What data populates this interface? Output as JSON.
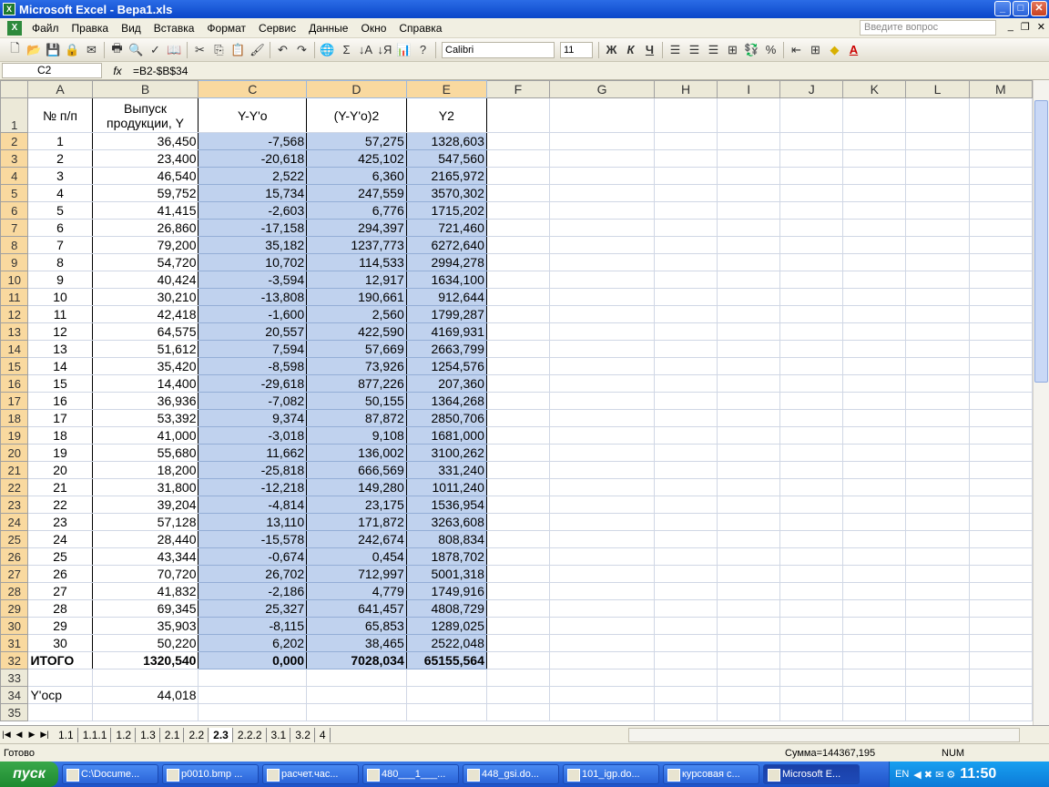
{
  "window": {
    "title": "Microsoft Excel - Вера1.xls"
  },
  "menu": [
    "Файл",
    "Правка",
    "Вид",
    "Вставка",
    "Формат",
    "Сервис",
    "Данные",
    "Окно",
    "Справка"
  ],
  "help_placeholder": "Введите вопрос",
  "toolbar": {
    "font": "Calibri",
    "size": "11",
    "bold": "Ж",
    "italic": "К",
    "underline": "Ч",
    "percent": "%"
  },
  "formula_bar": {
    "cell": "C2",
    "fx": "fx",
    "formula": "=B2-$B$34"
  },
  "columns": [
    "A",
    "B",
    "C",
    "D",
    "E",
    "F",
    "G",
    "H",
    "I",
    "J",
    "K",
    "L",
    "M"
  ],
  "header_row": {
    "a": "№ п/п",
    "b": "Выпуск продукции, Y",
    "c": "Y-Y'o",
    "d": "(Y-Y'o)2",
    "e": "Y2"
  },
  "rows": [
    [
      "1",
      "36,450",
      "-7,568",
      "57,275",
      "1328,603"
    ],
    [
      "2",
      "23,400",
      "-20,618",
      "425,102",
      "547,560"
    ],
    [
      "3",
      "46,540",
      "2,522",
      "6,360",
      "2165,972"
    ],
    [
      "4",
      "59,752",
      "15,734",
      "247,559",
      "3570,302"
    ],
    [
      "5",
      "41,415",
      "-2,603",
      "6,776",
      "1715,202"
    ],
    [
      "6",
      "26,860",
      "-17,158",
      "294,397",
      "721,460"
    ],
    [
      "7",
      "79,200",
      "35,182",
      "1237,773",
      "6272,640"
    ],
    [
      "8",
      "54,720",
      "10,702",
      "114,533",
      "2994,278"
    ],
    [
      "9",
      "40,424",
      "-3,594",
      "12,917",
      "1634,100"
    ],
    [
      "10",
      "30,210",
      "-13,808",
      "190,661",
      "912,644"
    ],
    [
      "11",
      "42,418",
      "-1,600",
      "2,560",
      "1799,287"
    ],
    [
      "12",
      "64,575",
      "20,557",
      "422,590",
      "4169,931"
    ],
    [
      "13",
      "51,612",
      "7,594",
      "57,669",
      "2663,799"
    ],
    [
      "14",
      "35,420",
      "-8,598",
      "73,926",
      "1254,576"
    ],
    [
      "15",
      "14,400",
      "-29,618",
      "877,226",
      "207,360"
    ],
    [
      "16",
      "36,936",
      "-7,082",
      "50,155",
      "1364,268"
    ],
    [
      "17",
      "53,392",
      "9,374",
      "87,872",
      "2850,706"
    ],
    [
      "18",
      "41,000",
      "-3,018",
      "9,108",
      "1681,000"
    ],
    [
      "19",
      "55,680",
      "11,662",
      "136,002",
      "3100,262"
    ],
    [
      "20",
      "18,200",
      "-25,818",
      "666,569",
      "331,240"
    ],
    [
      "21",
      "31,800",
      "-12,218",
      "149,280",
      "1011,240"
    ],
    [
      "22",
      "39,204",
      "-4,814",
      "23,175",
      "1536,954"
    ],
    [
      "23",
      "57,128",
      "13,110",
      "171,872",
      "3263,608"
    ],
    [
      "24",
      "28,440",
      "-15,578",
      "242,674",
      "808,834"
    ],
    [
      "25",
      "43,344",
      "-0,674",
      "0,454",
      "1878,702"
    ],
    [
      "26",
      "70,720",
      "26,702",
      "712,997",
      "5001,318"
    ],
    [
      "27",
      "41,832",
      "-2,186",
      "4,779",
      "1749,916"
    ],
    [
      "28",
      "69,345",
      "25,327",
      "641,457",
      "4808,729"
    ],
    [
      "29",
      "35,903",
      "-8,115",
      "65,853",
      "1289,025"
    ],
    [
      "30",
      "50,220",
      "6,202",
      "38,465",
      "2522,048"
    ]
  ],
  "total_row": {
    "a": "ИТОГО",
    "b": "1320,540",
    "c": "0,000",
    "d": "7028,034",
    "e": "65155,564"
  },
  "avg_row": {
    "a": "Y'оср",
    "b": "44,018"
  },
  "sheets": [
    "1.1",
    "1.1.1",
    "1.2",
    "1.3",
    "2.1",
    "2.2",
    "2.3",
    "2.2.2",
    "3.1",
    "3.2",
    "4"
  ],
  "active_sheet": "2.3",
  "status": {
    "ready": "Готово",
    "sum": "Сумма=144367,195",
    "num": "NUM"
  },
  "taskbar": {
    "start": "пуск",
    "tasks": [
      "C:\\Docume...",
      "p0010.bmp ...",
      "расчет.час...",
      "480___1___...",
      "448_gsi.do...",
      "101_igp.do...",
      "курсовая с...",
      "Microsoft E..."
    ],
    "lang": "EN",
    "clock": "11:50"
  }
}
